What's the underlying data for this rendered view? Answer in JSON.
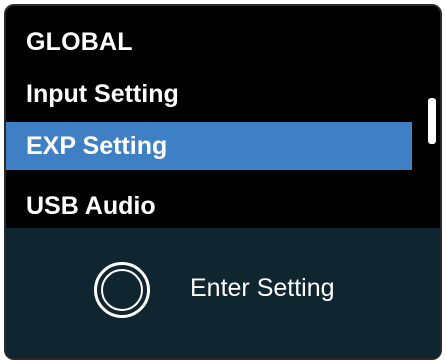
{
  "menu": {
    "title": "GLOBAL",
    "items": [
      {
        "label": "Input Setting",
        "selected": false
      },
      {
        "label": "EXP Setting",
        "selected": true
      },
      {
        "label": "USB Audio",
        "selected": false
      }
    ]
  },
  "footer": {
    "action_icon": "rotary-knob-icon",
    "action_label": "Enter Setting"
  },
  "colors": {
    "background": "#000000",
    "selection": "#3f7fc4",
    "footer": "#0f2530",
    "text": "#ffffff"
  }
}
